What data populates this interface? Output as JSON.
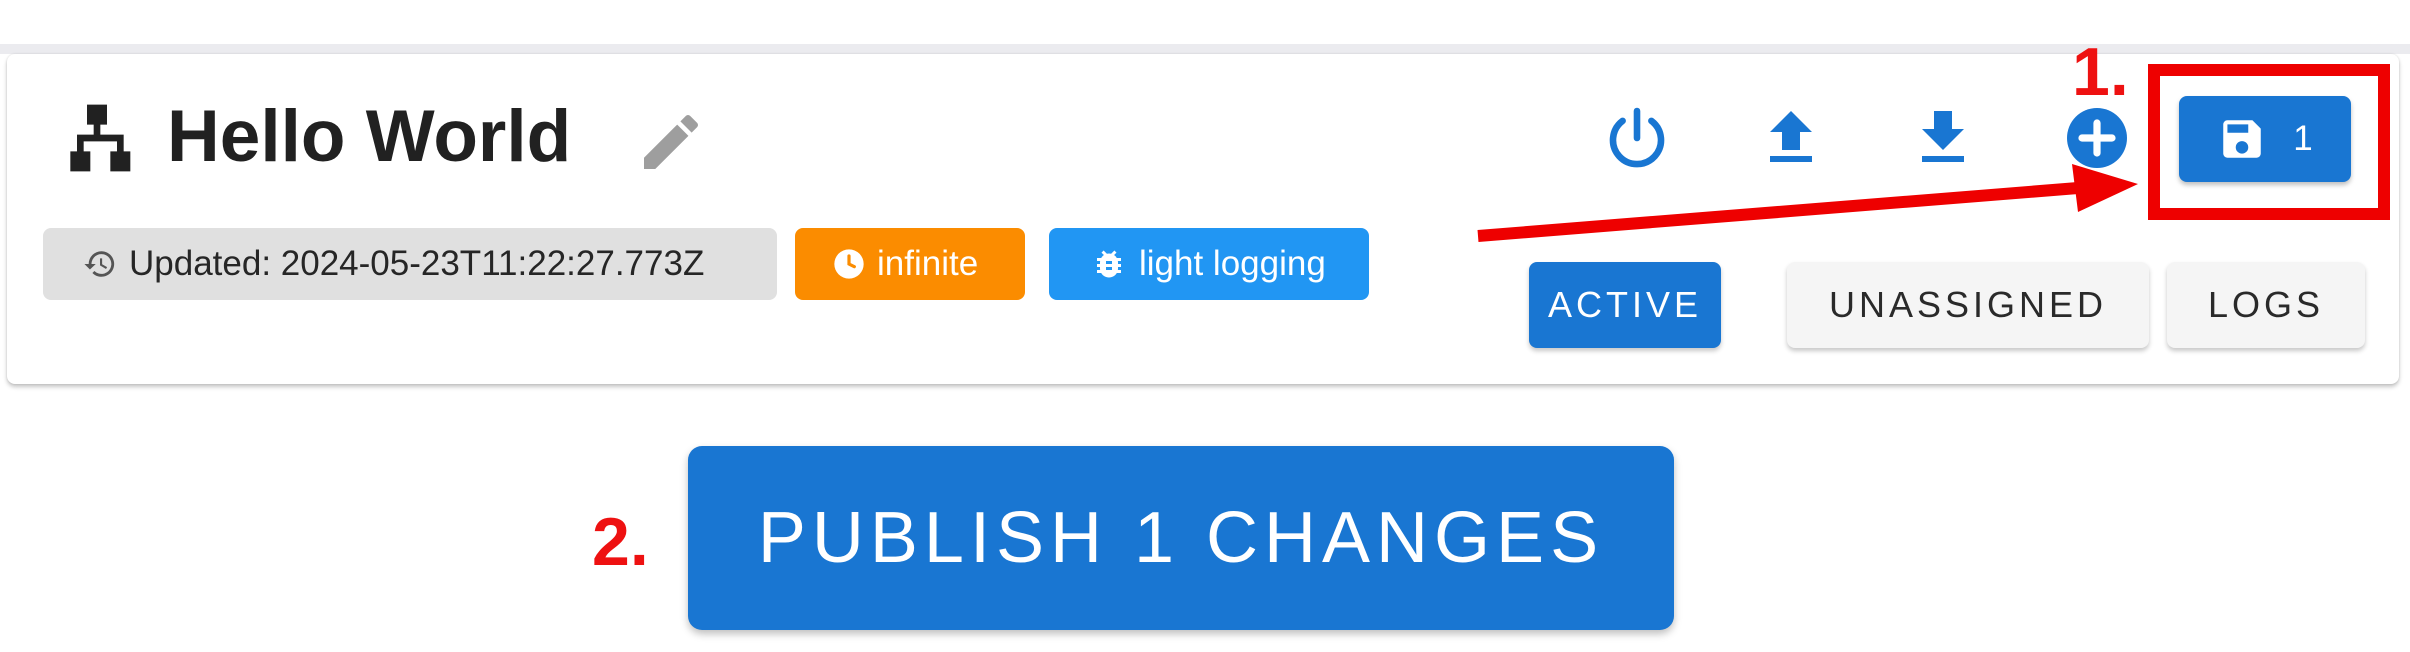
{
  "header": {
    "title": "Hello World",
    "app_icon": "sitemap-icon",
    "edit_icon": "pencil-icon"
  },
  "chips": {
    "updated": "Updated: 2024-05-23T11:22:27.773Z",
    "infinite": "infinite",
    "logging": "light logging"
  },
  "toolbar": {
    "icons": [
      "power-icon",
      "upload-icon",
      "download-icon",
      "add-circle-icon"
    ],
    "save_count": "1",
    "save_icon": "floppy-disk-icon"
  },
  "tabs": {
    "active": "ACTIVE",
    "unassigned": "UNASSIGNED",
    "logs": "LOGS"
  },
  "publish": {
    "label": "PUBLISH 1 CHANGES"
  },
  "annotations": {
    "step1": "1.",
    "step2": "2.",
    "color": "#ee0000"
  },
  "colors": {
    "primary": "#1976d2",
    "orange": "#fb8c00",
    "light_blue": "#2196f3",
    "chip_gray": "#e0e0e0"
  }
}
